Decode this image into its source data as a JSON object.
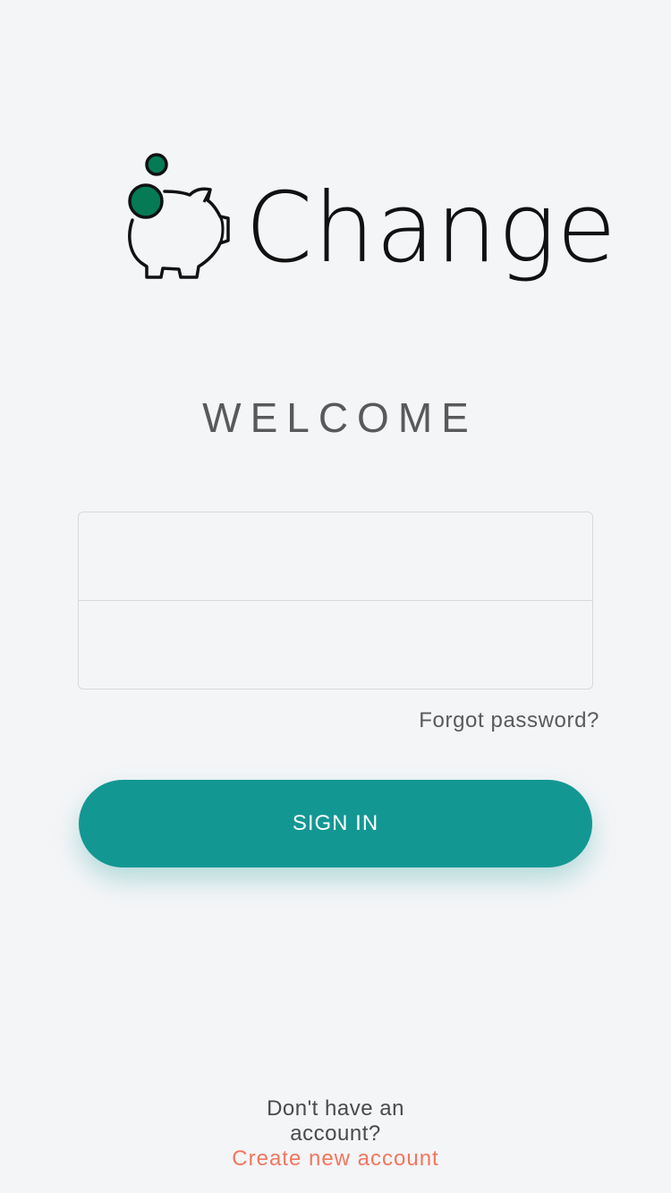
{
  "brand": {
    "name": "Change",
    "logo_icon": "piggy-bank-coin-icon",
    "coin_color": "#057a55"
  },
  "welcome": {
    "title": "WELCOME"
  },
  "form": {
    "username_placeholder": "",
    "password_placeholder": "",
    "forgot_label": "Forgot password?",
    "signin_label": "SIGN IN"
  },
  "footer": {
    "question": "Don't have an account?",
    "create_label": "Create new account"
  },
  "colors": {
    "accent": "#139793",
    "link": "#f2765e",
    "background": "#f4f5f7"
  }
}
